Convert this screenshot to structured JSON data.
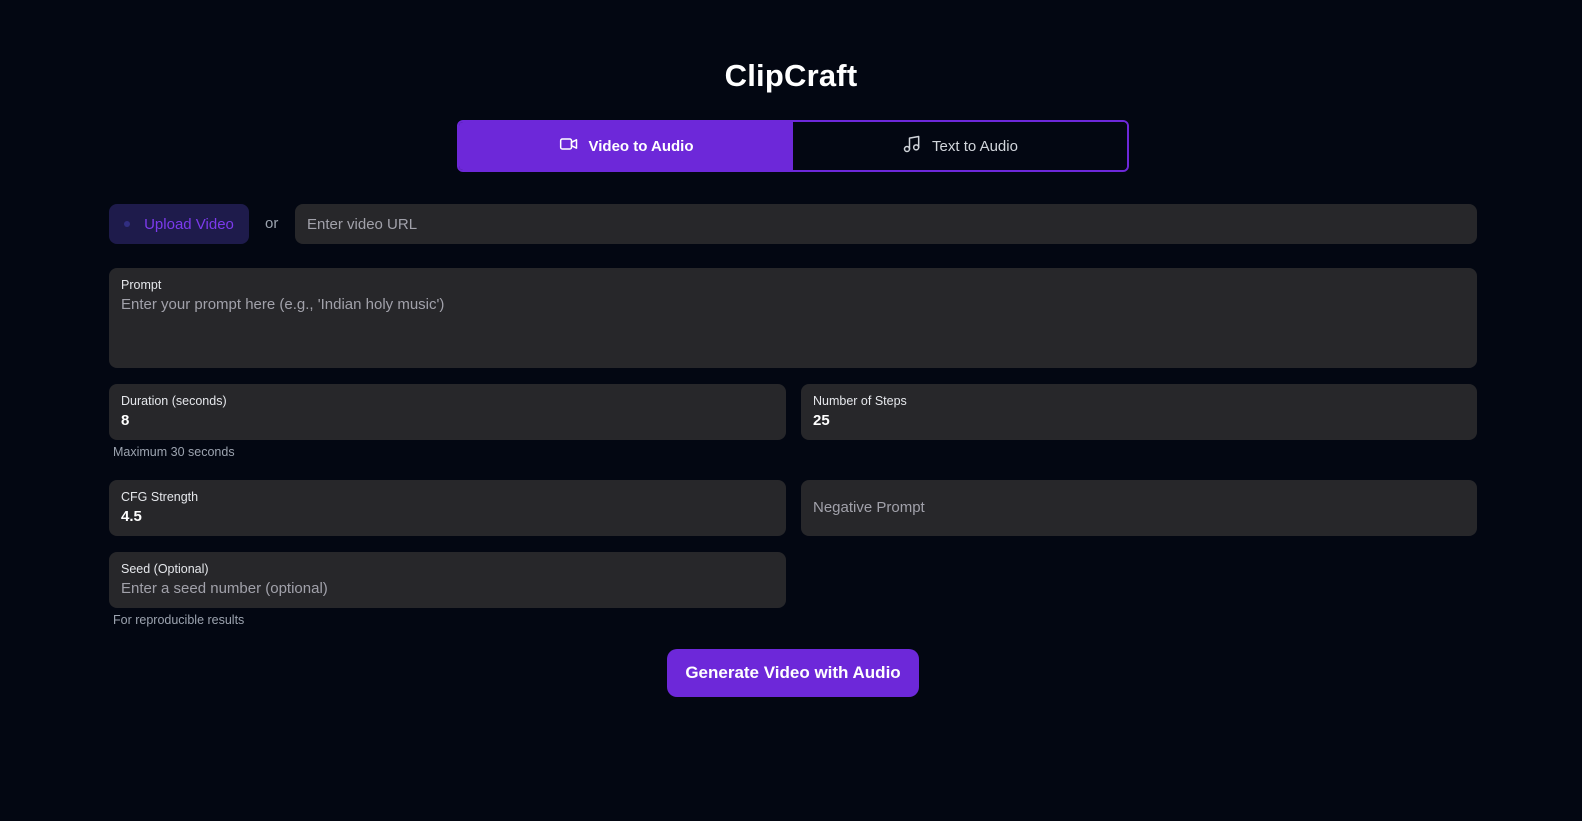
{
  "app": {
    "title": "ClipCraft"
  },
  "tabs": [
    {
      "label": "Video to Audio",
      "icon": "video-camera-icon",
      "active": true
    },
    {
      "label": "Text to Audio",
      "icon": "music-note-icon",
      "active": false
    }
  ],
  "upload": {
    "button_label": "Upload Video",
    "separator": "or",
    "url_placeholder": "Enter video URL",
    "url_value": ""
  },
  "prompt": {
    "label": "Prompt",
    "placeholder": "Enter your prompt here (e.g., 'Indian holy music')",
    "value": ""
  },
  "duration": {
    "label": "Duration (seconds)",
    "value": "8",
    "hint": "Maximum 30 seconds"
  },
  "steps": {
    "label": "Number of Steps",
    "value": "25"
  },
  "cfg": {
    "label": "CFG Strength",
    "value": "4.5"
  },
  "negative_prompt": {
    "placeholder": "Negative Prompt",
    "value": ""
  },
  "seed": {
    "label": "Seed (Optional)",
    "placeholder": "Enter a seed number (optional)",
    "value": "",
    "hint": "For reproducible results"
  },
  "generate": {
    "label": "Generate Video with Audio"
  },
  "colors": {
    "background": "#030712",
    "accent": "#6d28d9",
    "field": "#27272a",
    "upload_bg": "#1e1b4b"
  }
}
